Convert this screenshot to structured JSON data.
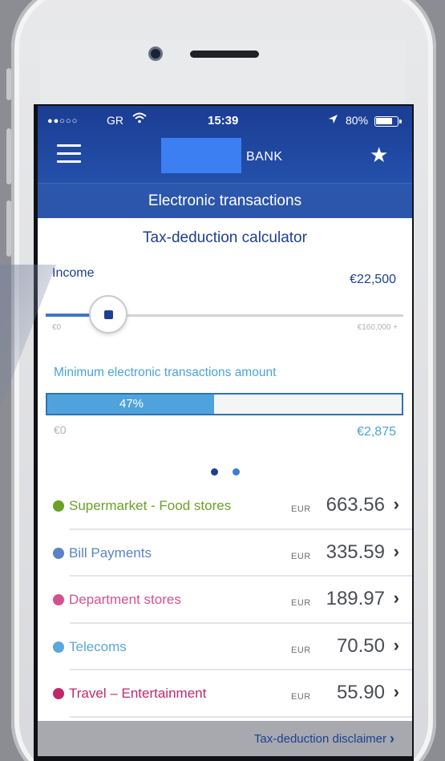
{
  "status_bar": {
    "signal": "●●○○○",
    "carrier": "GR",
    "wifi_icon": "wifi-icon",
    "time": "15:39",
    "location_icon": "location-arrow-icon",
    "battery_percent": "80%",
    "battery_level": 0.8
  },
  "header": {
    "menu_icon": "hamburger-menu-icon",
    "logo_text": "BANK",
    "favorite_icon": "star-icon",
    "section_title": "Electronic transactions"
  },
  "calculator": {
    "title": "Tax-deduction calculator",
    "income_label": "Income",
    "income_value": "€22,500",
    "income_min": "€0",
    "income_max": "€160,000 +",
    "income_fraction": 0.14,
    "min_label": "Minimum electronic transactions amount",
    "progress_percent_label": "47%",
    "progress_fraction": 0.47,
    "progress_min": "€0",
    "progress_max": "€2,875"
  },
  "pager": {
    "pages": 2,
    "active_index": 0
  },
  "categories": [
    {
      "name": "Supermarket - Food stores",
      "currency": "EUR",
      "amount": "663.56",
      "color": "#6aa126"
    },
    {
      "name": "Bill Payments",
      "currency": "EUR",
      "amount": "335.59",
      "color": "#5b82c4"
    },
    {
      "name": "Department stores",
      "currency": "EUR",
      "amount": "189.97",
      "color": "#d3518f"
    },
    {
      "name": "Telecoms",
      "currency": "EUR",
      "amount": "70.50",
      "color": "#5aa7dd"
    },
    {
      "name": "Travel – Entertainment",
      "currency": "EUR",
      "amount": "55.90",
      "color": "#c0286a"
    }
  ],
  "footer": {
    "disclaimer": "Tax-deduction disclaimer"
  },
  "colors": {
    "brand_blue": "#1e3f8f",
    "header_blue": "#1b3d93",
    "accent_light_blue": "#4aa3dc"
  }
}
